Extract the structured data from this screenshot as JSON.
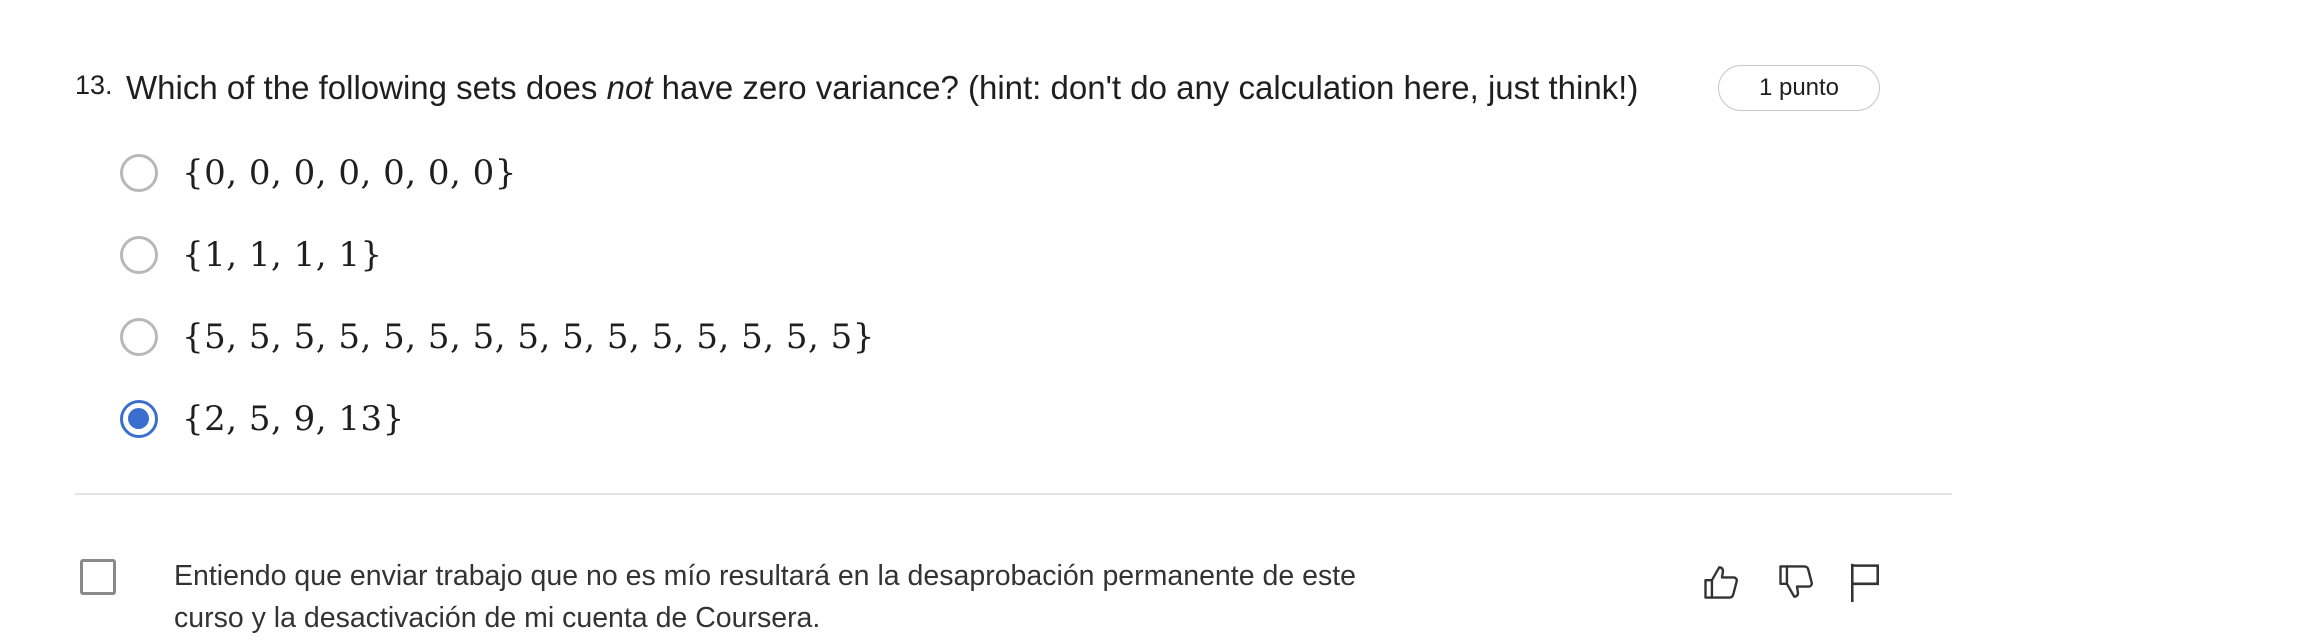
{
  "question": {
    "number": "13.",
    "text_before": "Which of the following sets does ",
    "text_emphasis": "not",
    "text_after": " have zero variance? (hint: don't do any calculation here, just think!)",
    "points": "1 punto",
    "options": [
      {
        "label": "{0, 0, 0, 0, 0, 0, 0}",
        "selected": false
      },
      {
        "label": "{1, 1, 1, 1}",
        "selected": false
      },
      {
        "label": "{5, 5, 5, 5, 5, 5, 5, 5, 5, 5, 5, 5, 5, 5, 5}",
        "selected": false
      },
      {
        "label": "{2, 5, 9, 13}",
        "selected": true
      }
    ]
  },
  "honor_code": {
    "checked": false,
    "line1": "Entiendo que enviar trabajo que no es mío resultará en la desaprobación permanente de este",
    "line2": "curso y la desactivación de mi cuenta de Coursera."
  },
  "feedback": {
    "icons": [
      "thumbs-up-icon",
      "thumbs-down-icon",
      "flag-icon"
    ]
  },
  "colors": {
    "accent": "#3a6fd0",
    "text": "#1f1f1f",
    "divider": "#e3e3e3"
  }
}
